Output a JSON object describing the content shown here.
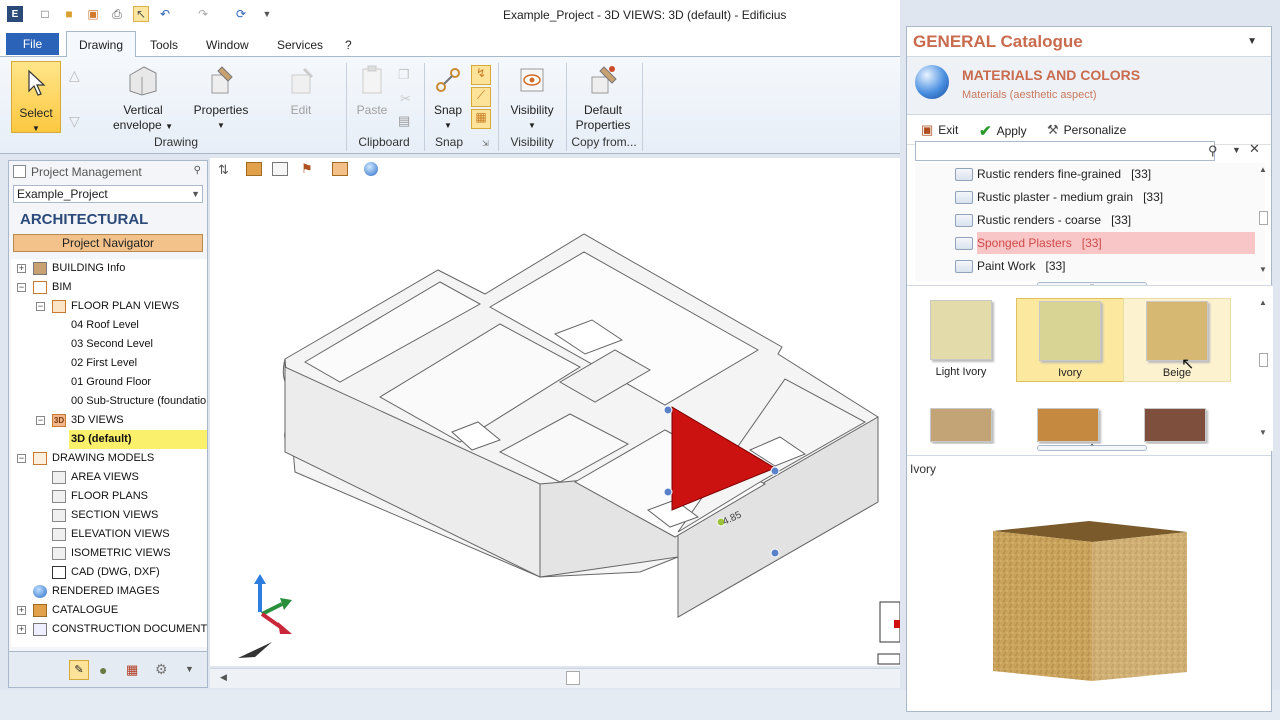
{
  "app": {
    "title": "Example_Project -  3D VIEWS: 3D (default) - Edificius"
  },
  "qat": {
    "icons": [
      "app-icon",
      "new-icon",
      "open-icon",
      "save-icon",
      "print-icon",
      "pointer-icon",
      "undo-icon",
      "redo-icon",
      "refresh-icon",
      "customize-icon"
    ]
  },
  "tabs": {
    "file": "File",
    "drawing": "Drawing",
    "tools": "Tools",
    "window": "Window",
    "services": "Services",
    "help": "?"
  },
  "ribbon": {
    "select": "Select",
    "vertical_envelope_1": "Vertical",
    "vertical_envelope_2": "envelope",
    "properties": "Properties",
    "edit": "Edit",
    "paste": "Paste",
    "snap": "Snap",
    "visibility": "Visibility",
    "default_properties_1": "Default",
    "default_properties_2": "Properties",
    "groups": {
      "drawing": "Drawing",
      "clipboard": "Clipboard",
      "snap": "Snap",
      "visibility": "Visibility",
      "copy_from": "Copy from..."
    }
  },
  "project": {
    "panel_title": "Project Management",
    "combo_value": "Example_Project",
    "section": "ARCHITECTURAL",
    "navigator": "Project Navigator",
    "tree": [
      {
        "label": "BUILDING Info"
      },
      {
        "label": "BIM"
      },
      {
        "label": "FLOOR PLAN VIEWS"
      },
      {
        "label": "04 Roof Level"
      },
      {
        "label": "03 Second Level"
      },
      {
        "label": "02 First Level"
      },
      {
        "label": "01 Ground Floor"
      },
      {
        "label": "00 Sub-Structure (foundatio"
      },
      {
        "label": "3D VIEWS"
      },
      {
        "label": "3D (default)"
      },
      {
        "label": "DRAWING MODELS"
      },
      {
        "label": "AREA VIEWS"
      },
      {
        "label": "FLOOR PLANS"
      },
      {
        "label": "SECTION VIEWS"
      },
      {
        "label": "ELEVATION VIEWS"
      },
      {
        "label": "ISOMETRIC VIEWS"
      },
      {
        "label": "CAD (DWG, DXF)"
      },
      {
        "label": "RENDERED IMAGES"
      },
      {
        "label": "CATALOGUE"
      },
      {
        "label": "CONSTRUCTION DOCUMENTS S"
      }
    ]
  },
  "viewport": {
    "dimension_label": "4.85",
    "selected_face_color": "#cc1111"
  },
  "catalogue": {
    "title": "GENERAL Catalogue",
    "heading": "MATERIALS AND COLORS",
    "subheading": "Materials (aesthetic aspect)",
    "exit": "Exit",
    "apply": "Apply",
    "personalize": "Personalize",
    "search_value": "",
    "list": [
      {
        "label": "Rustic renders fine-grained",
        "count": "[33]"
      },
      {
        "label": "Rustic plaster - medium grain",
        "count": "[33]"
      },
      {
        "label": "Rustic renders - coarse",
        "count": "[33]"
      },
      {
        "label": "Sponged Plasters",
        "count": "[33]"
      },
      {
        "label": "Paint Work",
        "count": "[33]"
      }
    ],
    "swatches": [
      {
        "label": "Light Ivory",
        "color": "#e3dcaa"
      },
      {
        "label": "Ivory",
        "color": "#d7d494"
      },
      {
        "label": "Beige",
        "color": "#d6b872"
      },
      {
        "label": "",
        "color": "#c2a476"
      },
      {
        "label": "",
        "color": "#c58a3f"
      },
      {
        "label": "",
        "color": "#7d4f3c"
      }
    ],
    "preview_label": "Ivory",
    "preview_color": "#c9a35c"
  }
}
